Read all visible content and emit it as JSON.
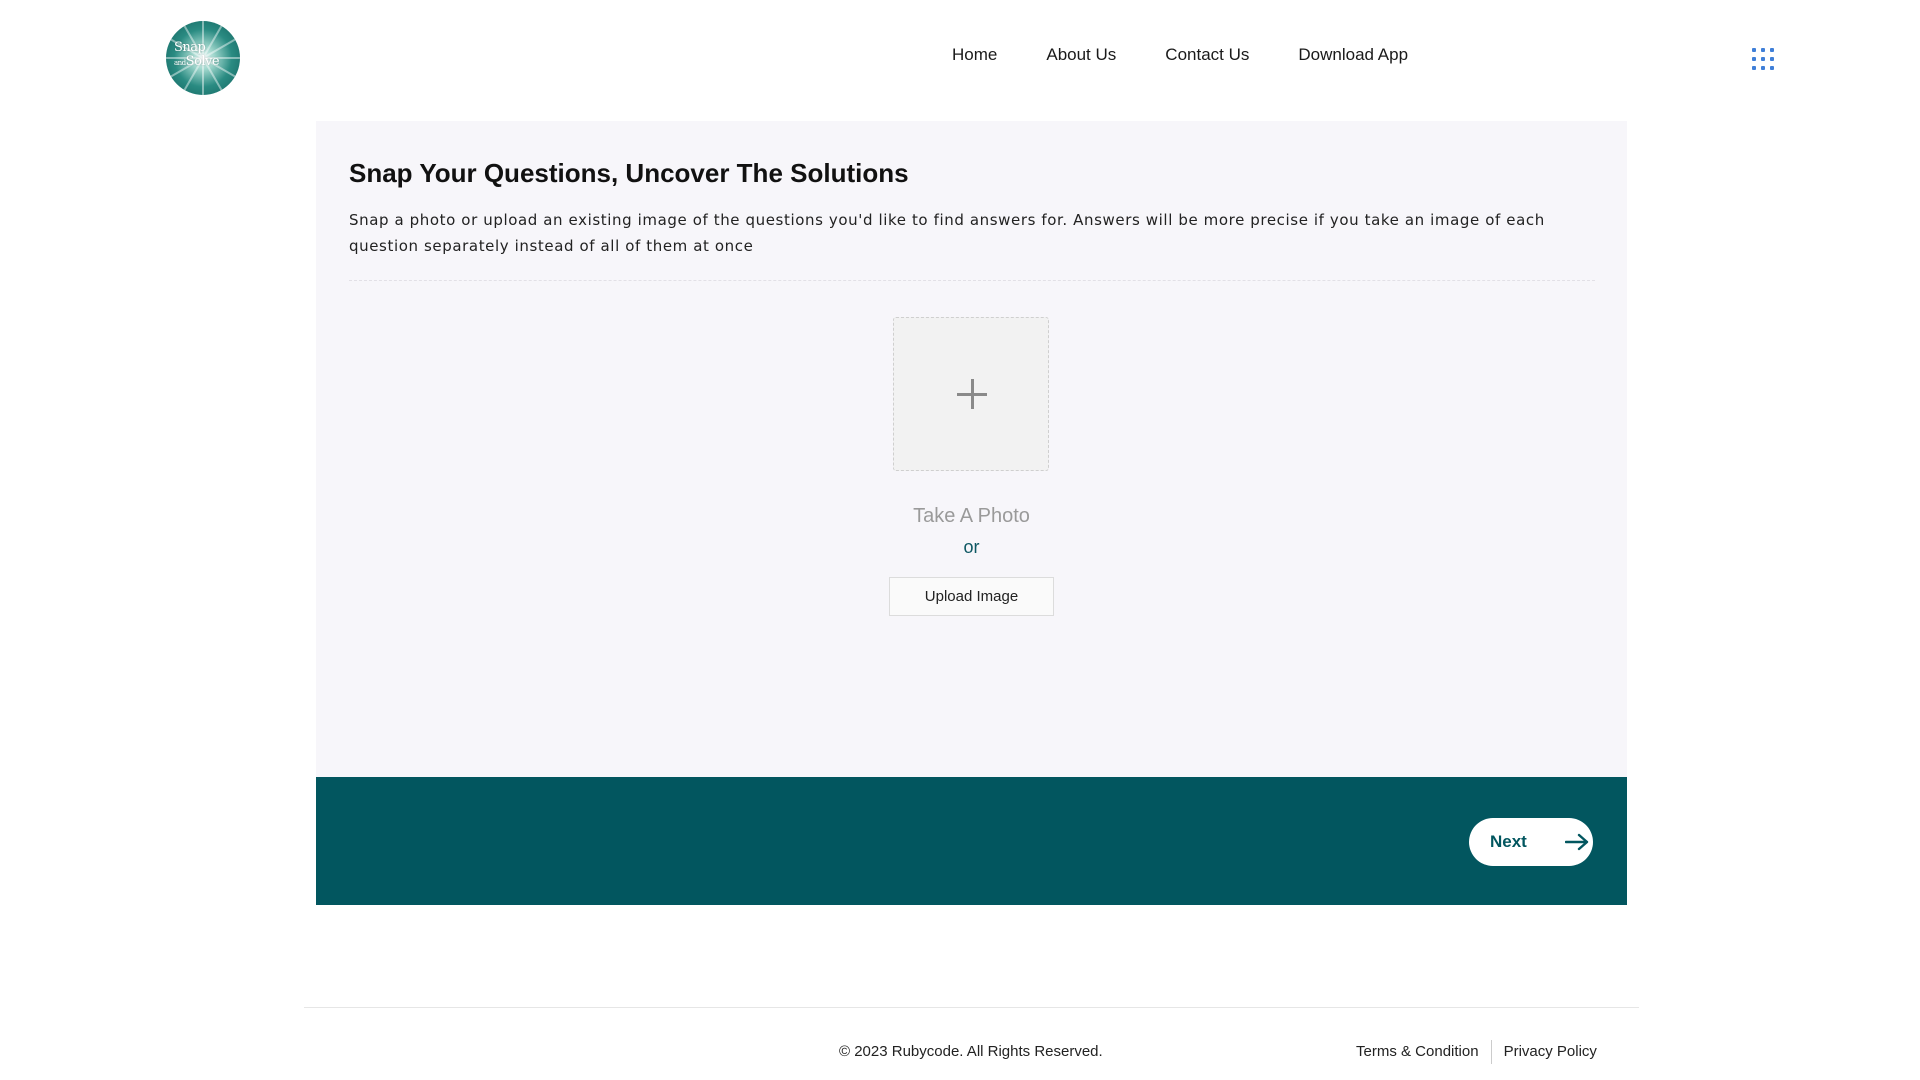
{
  "header": {
    "logo": {
      "line1": "Snap",
      "line2": "and",
      "line3": "Solve"
    },
    "nav": [
      {
        "label": "Home"
      },
      {
        "label": "About Us"
      },
      {
        "label": "Contact Us"
      },
      {
        "label": "Download App"
      }
    ],
    "menu_icon": "grid-menu-icon"
  },
  "main": {
    "title": "Snap Your Questions, Uncover The Solutions",
    "description": "Snap a photo or upload an existing image of the questions you'd like to find answers for. Answers will be more precise if you take an image of each question separately instead of all of them at once",
    "upload_box_icon": "plus-icon",
    "take_photo_label": "Take A Photo",
    "or_label": "or",
    "upload_button_label": "Upload Image"
  },
  "action_bar": {
    "next_label": "Next",
    "next_icon": "arrow-right-icon"
  },
  "footer": {
    "copyright": "© 2023 Rubycode. All Rights Reserved.",
    "links": [
      {
        "label": "Terms & Condition"
      },
      {
        "label": "Privacy Policy"
      }
    ]
  },
  "colors": {
    "accent": "#02565f",
    "card_background": "#f7f6fa",
    "menu_icon": "#3f7fd8"
  }
}
